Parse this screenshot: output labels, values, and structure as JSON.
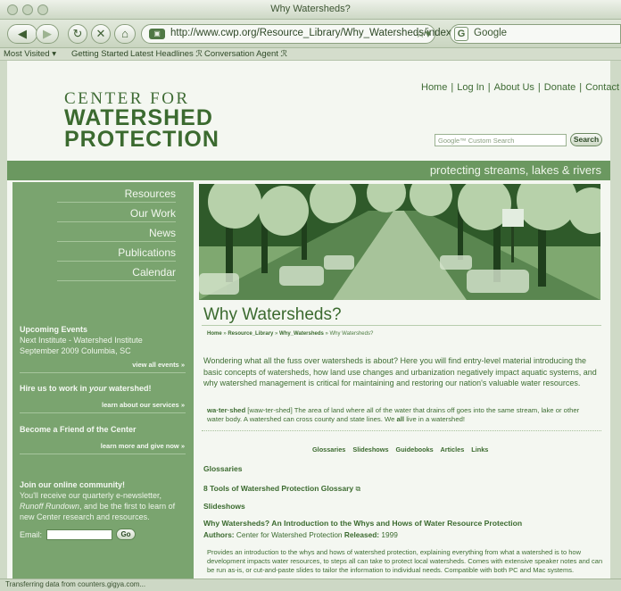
{
  "window": {
    "title": "Why Watersheds?"
  },
  "toolbar": {
    "url": "http://www.cwp.org/Resource_Library/Why_Watersheds/index.htm",
    "search_engine": "Google"
  },
  "bookmarks": [
    "Most Visited ▾",
    "Getting Started",
    "Latest Headlines ℛ",
    "Conversation Agent ℛ"
  ],
  "header": {
    "logo_line1": "CENTER FOR",
    "logo_line2": "WATERSHED",
    "logo_line3": "PROTECTION",
    "links": [
      "Home",
      "Log In",
      "About Us",
      "Donate",
      "Contact"
    ],
    "search_placeholder": "Google™ Custom Search",
    "search_button": "Search",
    "tagline": "protecting streams, lakes & rivers"
  },
  "sidebar": {
    "nav": [
      "Resources",
      "Our Work",
      "News",
      "Publications",
      "Calendar"
    ],
    "events_head": "Upcoming Events",
    "events_line1": "Next Institute - Watershed Institute",
    "events_line2": "September 2009 Columbia, SC",
    "events_link": "view all events »",
    "hire_head_pre": "Hire us to work in ",
    "hire_head_em": "your",
    "hire_head_post": " watershed!",
    "hire_link": "learn about our services »",
    "friend_head": "Become a Friend of the Center",
    "friend_link": "learn more and give now »",
    "community_head": "Join our online community!",
    "community_line1": "You'll receive our quarterly e-newsletter,",
    "community_line2_em": "Runoff Rundown",
    "community_line2_post": ", and be the first to learn of",
    "community_line3": "new Center research and resources.",
    "email_label": "Email:",
    "go_button": "Go"
  },
  "main": {
    "title": "Why Watersheds?",
    "breadcrumb": [
      "Home",
      "Resource_Library",
      "Why_Watersheds",
      "Why Watersheds?"
    ],
    "breadcrumb_sep": " » ",
    "intro": "Wondering what all the fuss over watersheds is about?  Here you will find entry-level material introducing the basic concepts of watersheds, how land use changes and urbanization negatively impact aquatic systems, and why watershed management is critical for maintaining and restoring our nation's valuable water resources.",
    "def_word": "wa·ter·shed",
    "def_text_a": " [waw-ter-shed] The area of land where all of the water that drains off goes into the same stream, lake or other water body. A watershed can cross county and state lines. We ",
    "def_all": "all",
    "def_text_b": " live in a watershed!",
    "tabs": [
      "Glossaries",
      "Slideshows",
      "Guidebooks",
      "Articles",
      "Links"
    ],
    "glossaries_head": "Glossaries",
    "glossary_link": "8 Tools of Watershed Protection Glossary",
    "slideshows_head": "Slideshows",
    "resource_title": "Why Watersheds? An Introduction to the Whys and Hows of Water Resource Protection",
    "authors_label": "Authors:",
    "authors_value": " Center for Watershed Protection ",
    "released_label": "Released:",
    "released_value": " 1999",
    "resource_desc": "Provides an introduction to the whys and hows of watershed protection, explaining everything from what a watershed is to how development impacts water resources, to steps all can take to protect local watersheds. Comes with extensive speaker notes and can be run as-is, or cut-and-paste slides to tailor the information to individual needs. Compatible with both PC and Mac systems."
  },
  "status": "Transferring data from counters.gigya.com...",
  "colors": {
    "accent_green": "#6b9860",
    "sidebar_green": "#7aa46f",
    "text_green": "#3b6a2f"
  },
  "icons": [
    "back-icon",
    "forward-icon",
    "reload-icon",
    "stop-icon",
    "home-icon",
    "bookmark-star-icon",
    "external-link-icon"
  ]
}
